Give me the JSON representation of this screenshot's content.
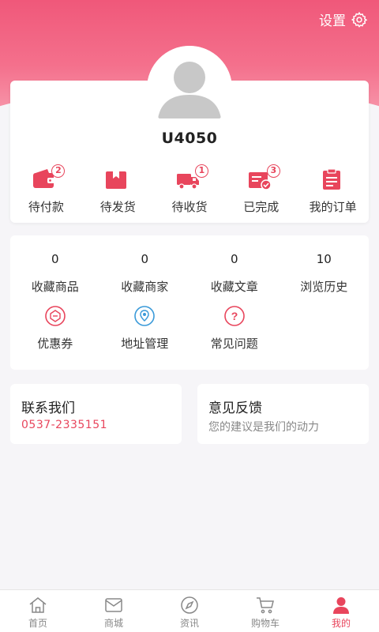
{
  "header": {
    "settings_label": "设置"
  },
  "profile": {
    "username": "U4050",
    "orders": [
      {
        "label": "待付款",
        "badge": "2",
        "icon": "wallet-icon"
      },
      {
        "label": "待发货",
        "badge": "",
        "icon": "package-icon"
      },
      {
        "label": "待收货",
        "badge": "1",
        "icon": "truck-icon"
      },
      {
        "label": "已完成",
        "badge": "3",
        "icon": "completed-icon"
      },
      {
        "label": "我的订单",
        "badge": "",
        "icon": "clipboard-icon"
      }
    ]
  },
  "stats": [
    {
      "value": "0",
      "label": "收藏商品"
    },
    {
      "value": "0",
      "label": "收藏商家"
    },
    {
      "value": "0",
      "label": "收藏文章"
    },
    {
      "value": "10",
      "label": "浏览历史"
    }
  ],
  "services": [
    {
      "label": "优惠券",
      "icon": "coupon-icon"
    },
    {
      "label": "地址管理",
      "icon": "location-icon"
    },
    {
      "label": "常见问题",
      "icon": "question-icon"
    }
  ],
  "contact": {
    "title": "联系我们",
    "phone": "0537-2335151"
  },
  "feedback": {
    "title": "意见反馈",
    "subtitle": "您的建议是我们的动力"
  },
  "tabbar": [
    {
      "label": "首页",
      "icon": "home-icon"
    },
    {
      "label": "商城",
      "icon": "mail-icon"
    },
    {
      "label": "资讯",
      "icon": "compass-icon"
    },
    {
      "label": "购物车",
      "icon": "cart-icon"
    },
    {
      "label": "我的",
      "icon": "user-icon",
      "active": true
    }
  ],
  "colors": {
    "accent": "#e8455c",
    "header_gradient_top": "#f0587a",
    "header_gradient_bottom": "#f89bae"
  }
}
